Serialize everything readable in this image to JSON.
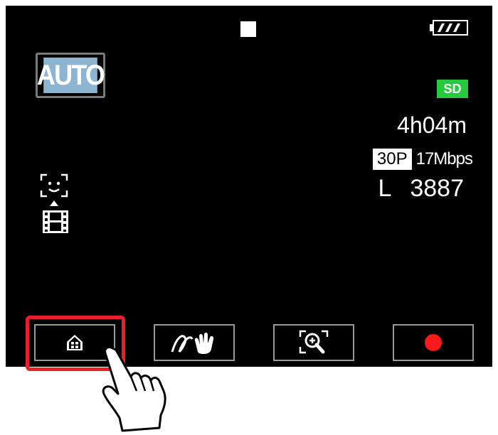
{
  "screen": {
    "auto_mode": "AUTO",
    "media": "SD",
    "remaining_time": "4h04m",
    "frame_rate": "30P",
    "bitrate": "17Mbps",
    "photo_size": "L",
    "photo_count": "3887"
  },
  "buttons": [
    {
      "name": "home-button",
      "icon": "home-icon"
    },
    {
      "name": "touch-decoration-button",
      "icon": "hand-wave-icon"
    },
    {
      "name": "zoom-button",
      "icon": "magnifier-plus-icon"
    },
    {
      "name": "record-button",
      "icon": "record-dot-icon"
    }
  ],
  "colors": {
    "highlight": "#e8202a",
    "sd_badge": "#27c93f",
    "auto_badge": "#8db4d1",
    "record_dot": "#ff1a1a"
  }
}
